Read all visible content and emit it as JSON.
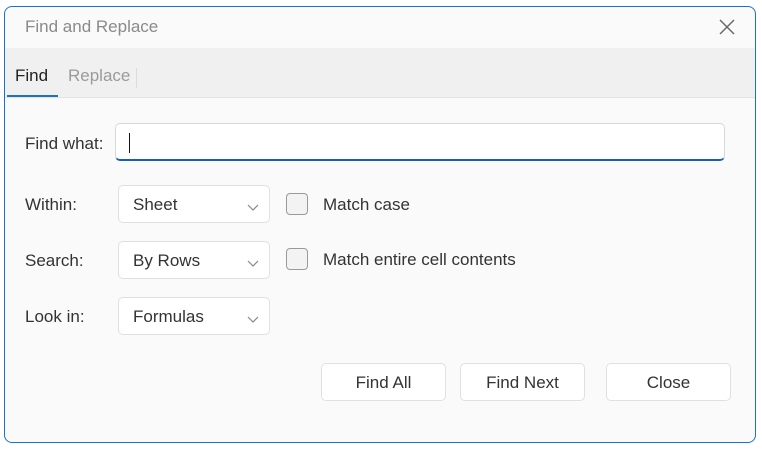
{
  "window": {
    "title": "Find and Replace",
    "close_icon": "close-icon"
  },
  "tabs": [
    {
      "label": "Find",
      "active": true
    },
    {
      "label": "Replace",
      "active": false
    }
  ],
  "form": {
    "find_what_label": "Find what:",
    "find_what_value": "",
    "within_label": "Within:",
    "within_value": "Sheet",
    "search_label": "Search:",
    "search_value": "By Rows",
    "look_in_label": "Look in:",
    "look_in_value": "Formulas",
    "match_case_label": "Match case",
    "match_case_checked": false,
    "match_entire_label": "Match entire cell contents",
    "match_entire_checked": false
  },
  "buttons": {
    "find_all": "Find All",
    "find_next": "Find Next",
    "close": "Close"
  },
  "colors": {
    "accent": "#1a73c7",
    "dialog_background": "#fafafa",
    "tabbar_background": "#f0f0f0"
  }
}
